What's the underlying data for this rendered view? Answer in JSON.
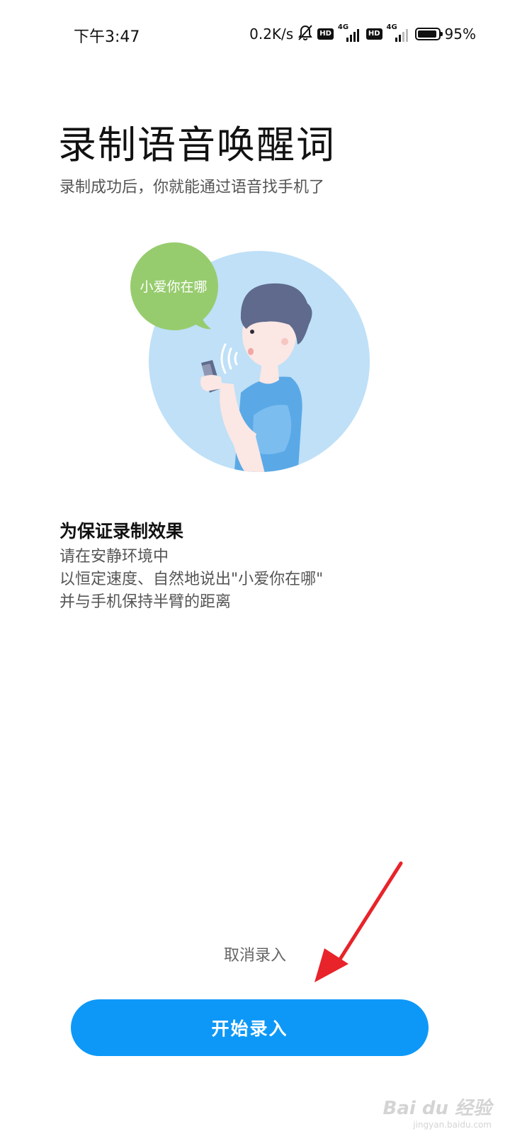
{
  "status_bar": {
    "time": "下午3:47",
    "net_speed": "0.2K/s",
    "hd_label": "HD",
    "network_type": "4G",
    "battery_percent_text": "95%",
    "battery_level": 0.95,
    "icons": [
      "bell-off-icon",
      "hd-icon",
      "signal-icon",
      "hd-icon",
      "signal-icon",
      "battery-icon"
    ]
  },
  "header": {
    "title": "录制语音唤醒词",
    "subtitle": "录制成功后，你就能通过语音找手机了"
  },
  "illustration": {
    "bubble_text": "小爱你在哪",
    "colors": {
      "circle": "#bfe0f7",
      "bubble": "#97cc6e",
      "hair": "#5f6a8c",
      "shirt": "#5aa9e6"
    }
  },
  "tips": {
    "heading": "为保证录制效果",
    "lines": [
      "请在安静环境中",
      "以恒定速度、自然地说出\"小爱你在哪\"",
      "并与手机保持半臂的距离"
    ]
  },
  "actions": {
    "cancel_label": "取消录入",
    "start_label": "开始录入",
    "accent_color": "#0d98f8"
  },
  "annotation": {
    "arrow_color": "#e8232a"
  },
  "watermark": {
    "main": "Bai du 经验",
    "sub": "jingyan.baidu.com"
  }
}
